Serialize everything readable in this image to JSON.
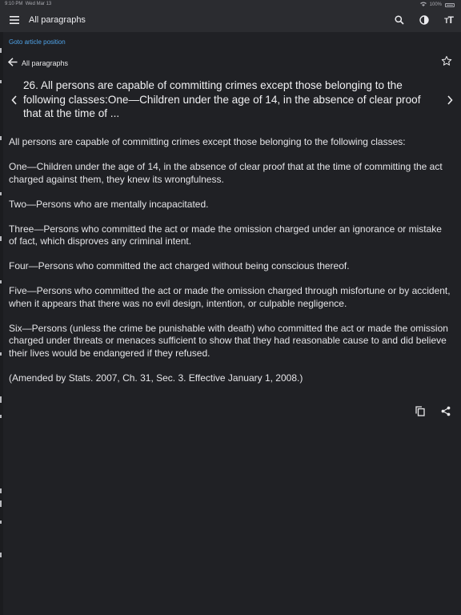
{
  "status_bar": {
    "time": "9:10 PM",
    "date": "Wed Mar 13",
    "battery": "100%"
  },
  "app_bar": {
    "title": "All paragraphs"
  },
  "goto_label": "Goto article position",
  "back_label": "All paragraphs",
  "heading": "26. All persons are capable of committing crimes except those belonging to the following classes:One—Children under the age of 14, in the absence of clear proof that at the time of ...",
  "paragraphs": [
    "All persons are capable of committing crimes except those belonging to the following classes:",
    "One—Children under the age of 14, in the absence of clear proof that at the time of committing the act charged against them, they knew its wrongfulness.",
    "Two—Persons who are mentally incapacitated.",
    "Three—Persons who committed the act or made the omission charged under an ignorance or mistake of fact, which disproves any criminal intent.",
    "Four—Persons who committed the act charged without being conscious thereof.",
    "Five—Persons who committed the act or made the omission charged through misfortune or by accident, when it appears that there was no evil design, intention, or culpable negligence.",
    "Six—Persons (unless the crime be punishable with death) who committed the act or made the omission charged under threats or menaces sufficient to show that they had reasonable cause to and did believe their lives would be endangered if they refused.",
    "(Amended by Stats. 2007, Ch. 31, Sec. 3. Effective January 1, 2008.)"
  ],
  "icons": {
    "menu": "hamburger-menu-icon",
    "search": "search-icon",
    "contrast": "contrast-icon",
    "font_size": "font-size-icon",
    "back": "arrow-left-icon",
    "star": "star-outline-icon",
    "prev": "chevron-left-icon",
    "next": "chevron-right-icon",
    "copy": "copy-icon",
    "share": "share-icon"
  },
  "colors": {
    "background": "#202125",
    "app_bar": "#2b2c30",
    "link": "#4fa3e8",
    "text": "#e8e8ea"
  }
}
